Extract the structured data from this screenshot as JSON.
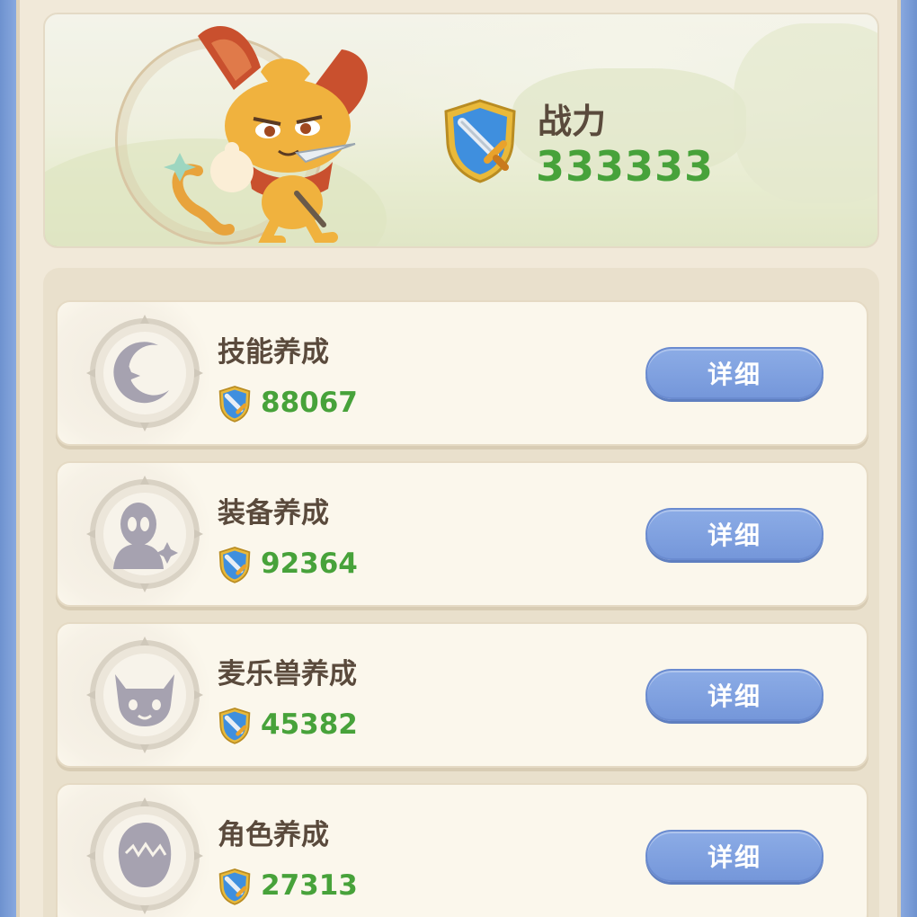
{
  "power": {
    "title": "战力",
    "value": "333333",
    "icon": "sword-shield-icon"
  },
  "cards": [
    {
      "title": "技能养成",
      "score": "88067",
      "button": "详细",
      "icon": "moon-star-icon"
    },
    {
      "title": "装备养成",
      "score": "92364",
      "button": "详细",
      "icon": "alien-sparkle-icon"
    },
    {
      "title": "麦乐兽养成",
      "score": "45382",
      "button": "详细",
      "icon": "cat-face-icon"
    },
    {
      "title": "角色养成",
      "score": "27313",
      "button": "详细",
      "icon": "hair-head-icon"
    }
  ],
  "colors": {
    "accent_green": "#47a23a",
    "button_blue": "#7d9ee0",
    "frame_blue": "#7d9fd8",
    "panel_beige": "#f1e9d9",
    "title_brown": "#5a4a3c"
  }
}
